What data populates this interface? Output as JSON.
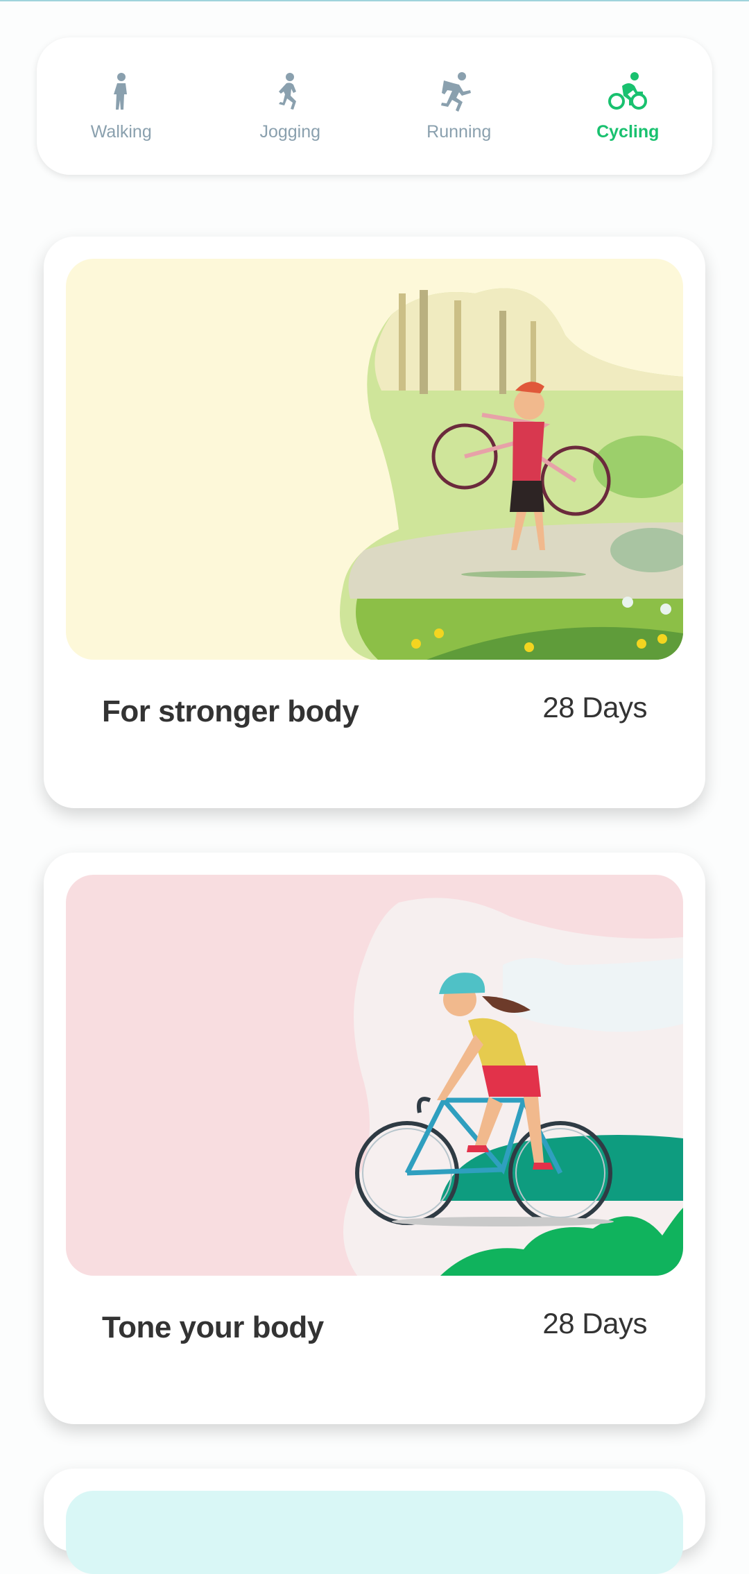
{
  "tabs": [
    {
      "label": "Walking",
      "icon": "walking-icon",
      "active": false
    },
    {
      "label": "Jogging",
      "icon": "jogging-icon",
      "active": false
    },
    {
      "label": "Running",
      "icon": "running-icon",
      "active": false
    },
    {
      "label": "Cycling",
      "icon": "cycling-icon",
      "active": true
    }
  ],
  "cards": [
    {
      "title": "For stronger body",
      "duration": "28 Days",
      "art_bg": "#fdf8d9"
    },
    {
      "title": "Tone your body",
      "duration": "28 Days",
      "art_bg": "#f8dde0"
    },
    {
      "title": "",
      "duration": "",
      "art_bg": "#d9f7f6"
    }
  ],
  "colors": {
    "accent": "#19c16f",
    "inactive": "#8aa0ae",
    "text": "#333333"
  }
}
